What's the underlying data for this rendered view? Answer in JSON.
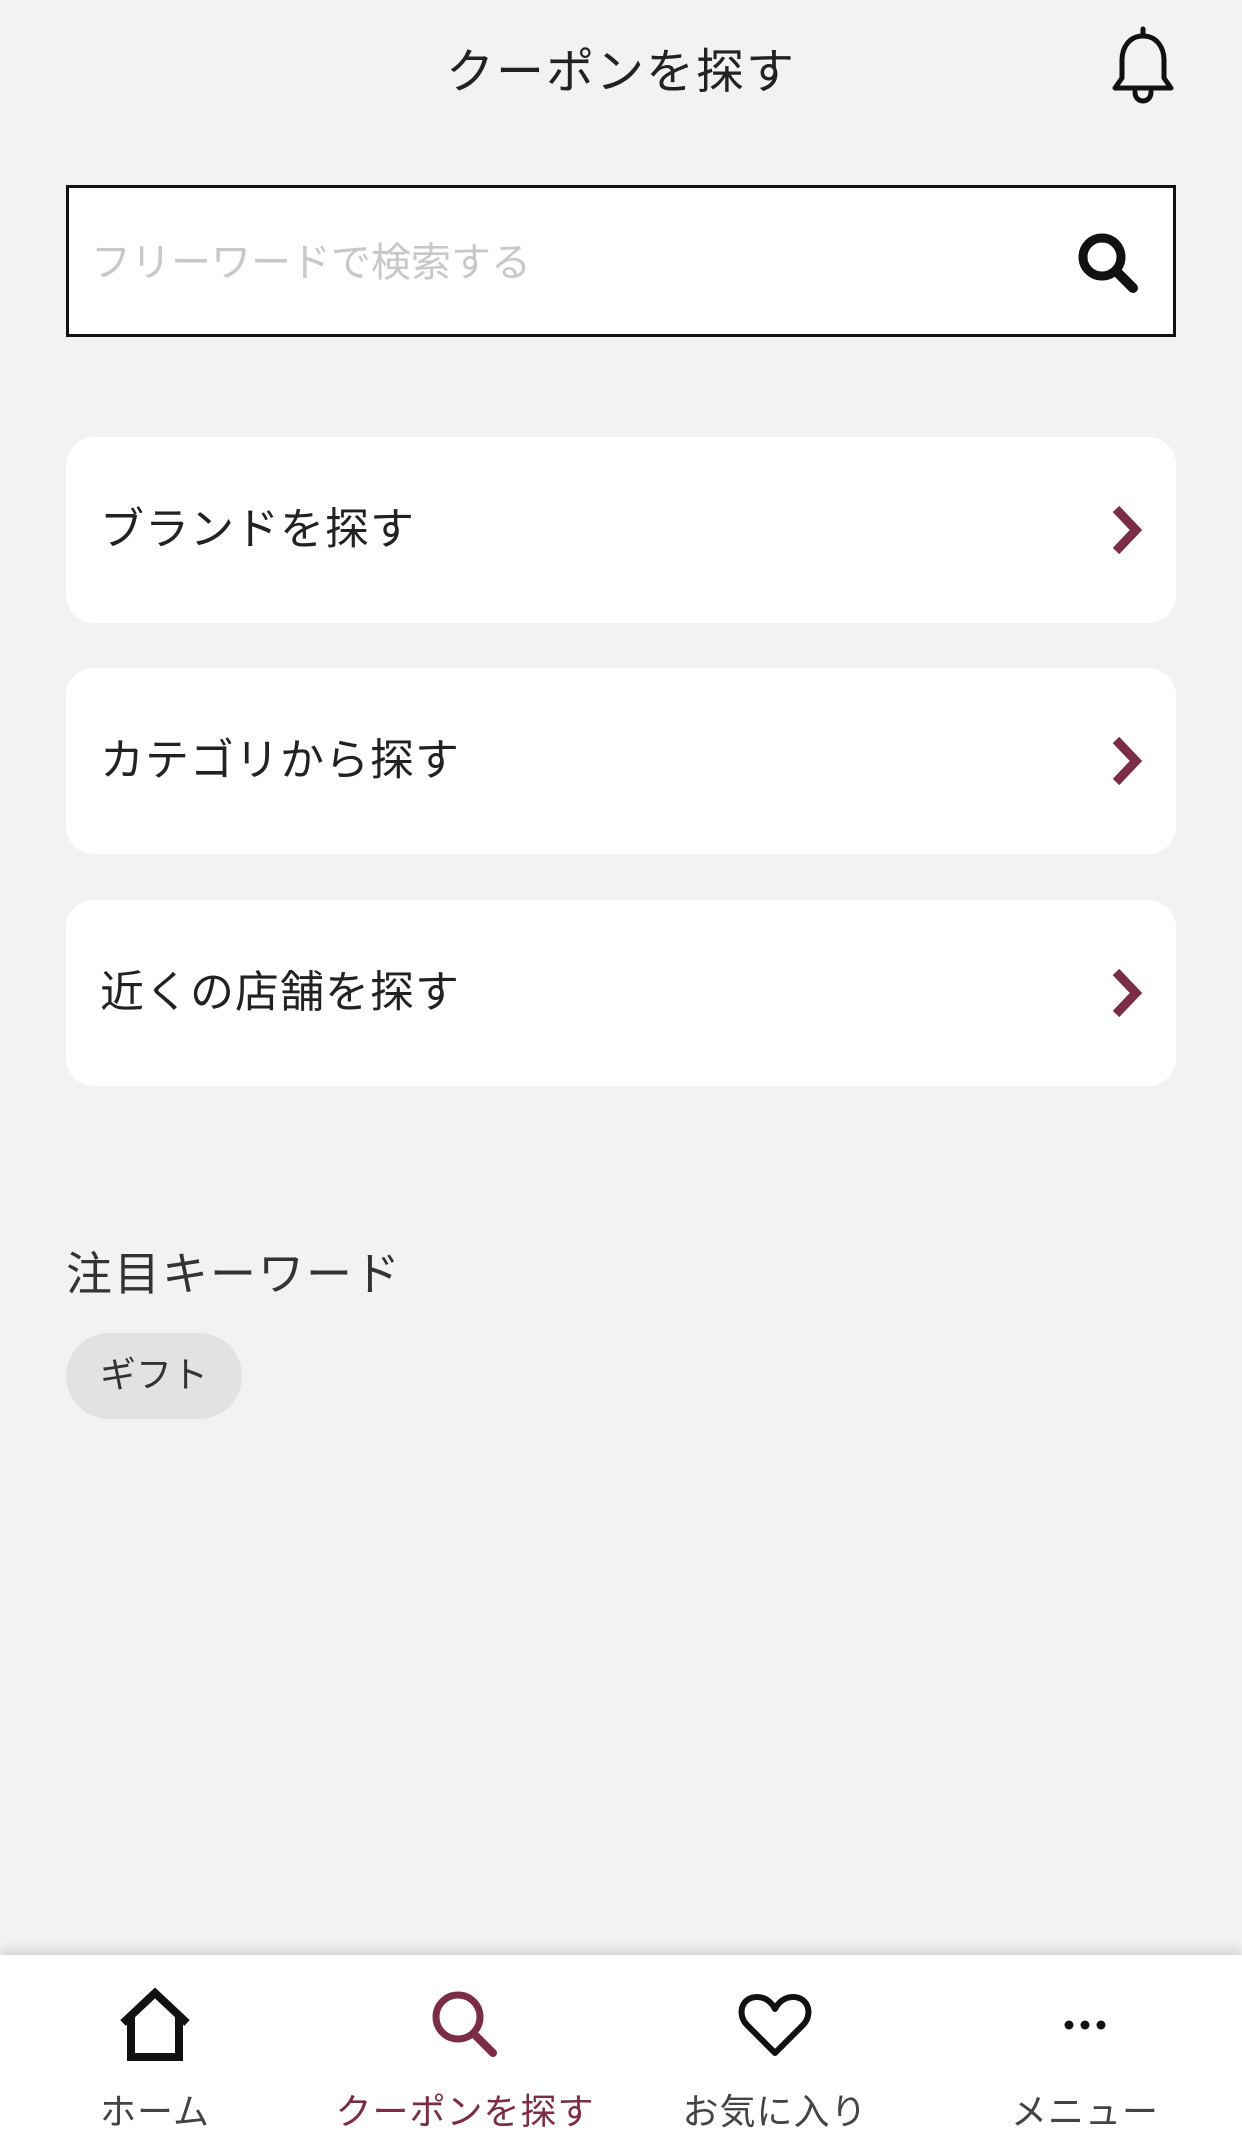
{
  "header": {
    "title": "クーポンを探す",
    "bell_icon": "bell-icon"
  },
  "search": {
    "placeholder": "フリーワードで検索する",
    "value": "",
    "icon": "search-icon"
  },
  "menu": {
    "items": [
      {
        "label": "ブランドを探す"
      },
      {
        "label": "カテゴリから探す"
      },
      {
        "label": "近くの店舗を探す"
      }
    ],
    "chevron_icon": "chevron-right-icon",
    "chevron_color": "#7b2d45"
  },
  "keywords": {
    "title": "注目キーワード",
    "items": [
      "ギフト"
    ]
  },
  "nav": {
    "items": [
      {
        "label": "ホーム",
        "icon": "home-icon",
        "active": false
      },
      {
        "label": "クーポンを探す",
        "icon": "search-icon",
        "active": true
      },
      {
        "label": "お気に入り",
        "icon": "heart-icon",
        "active": false
      },
      {
        "label": "メニュー",
        "icon": "more-icon",
        "active": false
      }
    ],
    "accent_color": "#7b2d45"
  }
}
